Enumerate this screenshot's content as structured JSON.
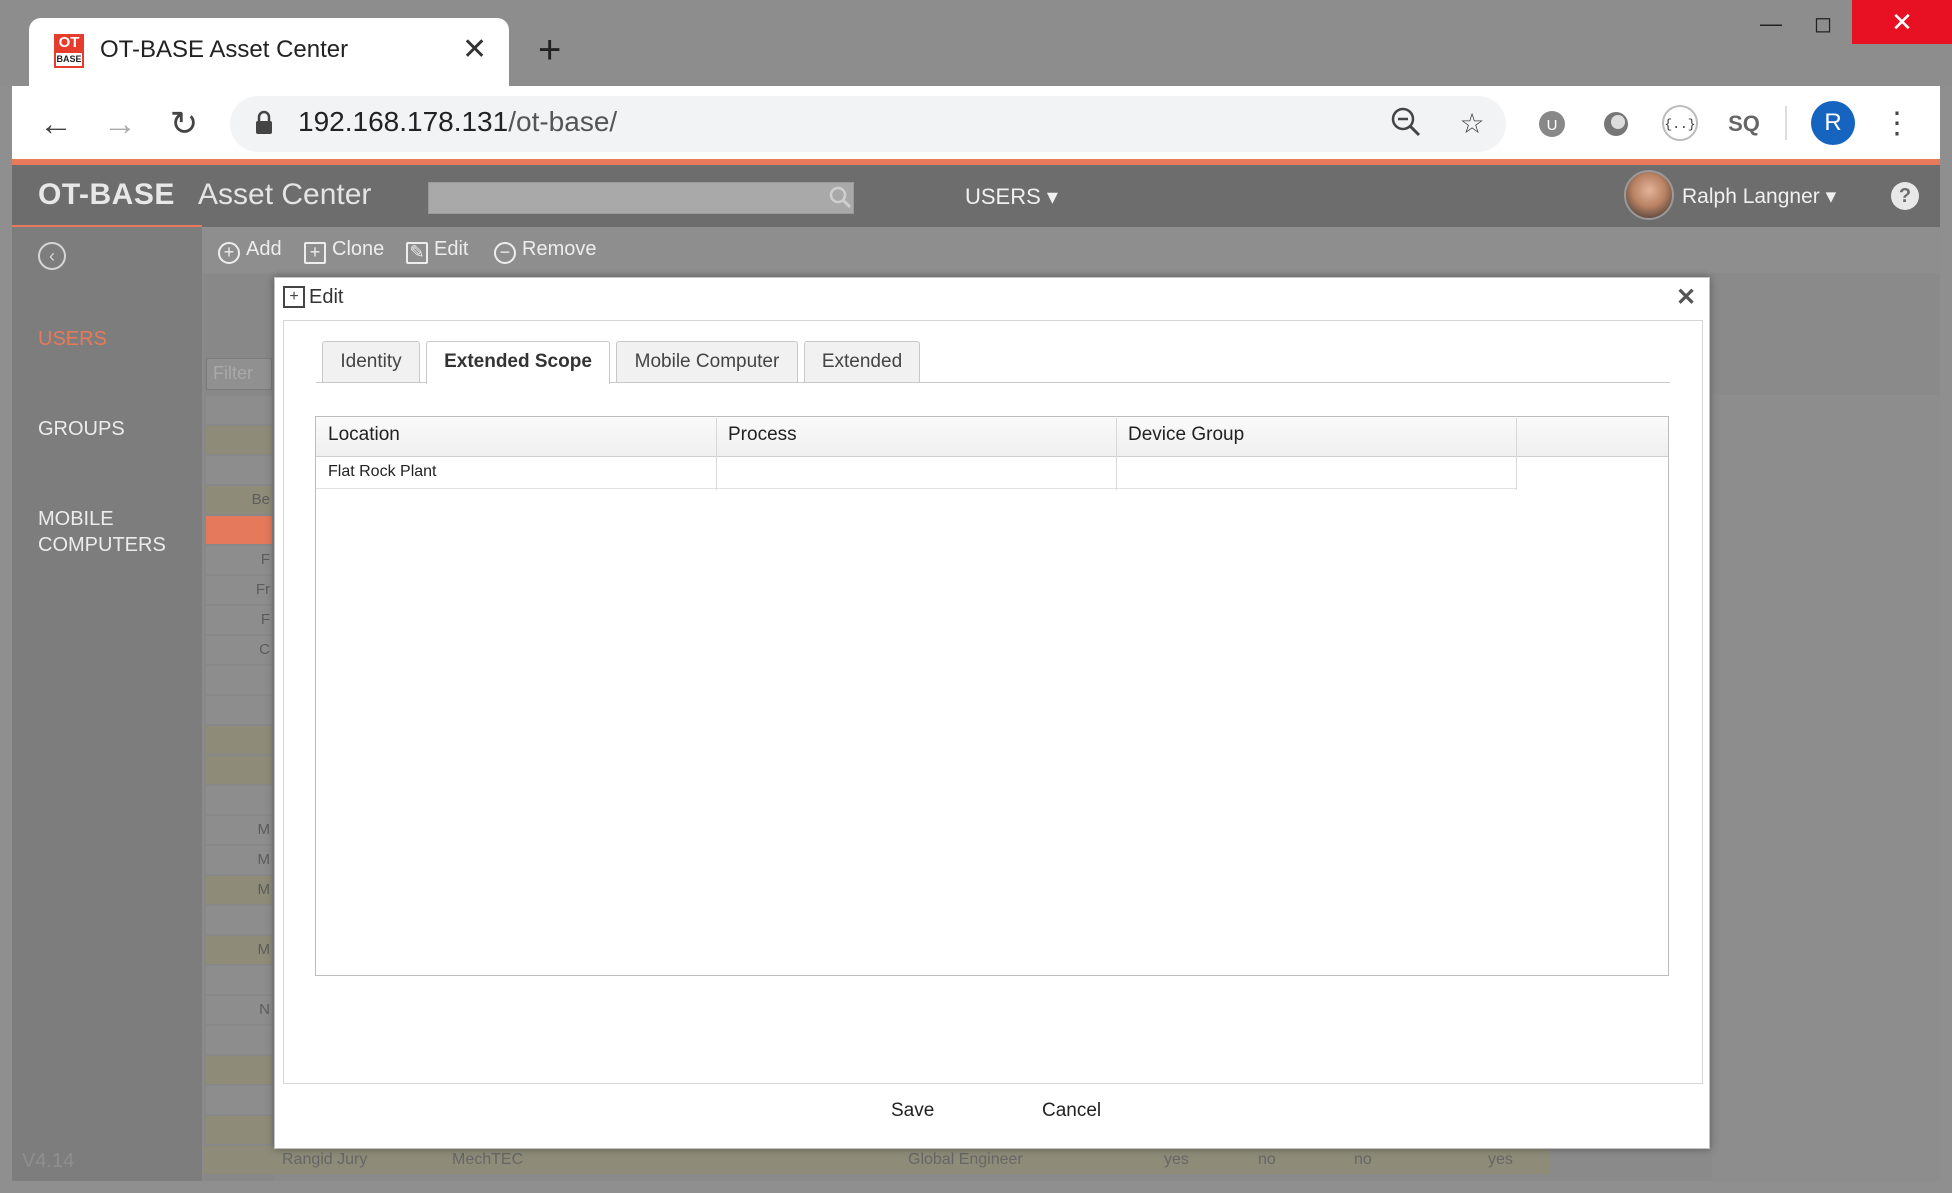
{
  "browser": {
    "tab_title": "OT-BASE Asset Center",
    "favicon_top": "OT",
    "favicon_bottom": "BASE",
    "url_host": "192.168.178.131",
    "url_path": "/ot-base/",
    "profile_initial": "R"
  },
  "app": {
    "brand": "OT-BASE",
    "subtitle": "Asset Center",
    "menu": "USERS ▾",
    "user_name": "Ralph Langner ▾",
    "help": "?",
    "version": "V4.14"
  },
  "sidebar": {
    "items": [
      {
        "label": "USERS",
        "active": true
      },
      {
        "label": "GROUPS"
      },
      {
        "label": "MOBILE COMPUTERS"
      }
    ]
  },
  "toolbar": {
    "add": "Add",
    "clone": "Clone",
    "edit": "Edit",
    "remove": "Remove"
  },
  "list": {
    "filter_placeholder": "Filter",
    "row_fragments": [
      "Be",
      "F",
      "Fr",
      "F",
      "C",
      "M",
      "M",
      "M",
      "M",
      "N"
    ],
    "bottom_row": [
      "Rangid Jury",
      "MechTEC",
      "Global Engineer",
      "yes",
      "no",
      "no",
      "yes"
    ]
  },
  "modal": {
    "title": "Edit",
    "tabs": [
      "Identity",
      "Extended Scope",
      "Mobile Computer",
      "Extended"
    ],
    "active_tab": "Extended Scope",
    "columns": [
      "Location",
      "Process",
      "Device Group"
    ],
    "rows": [
      {
        "location": "Flat Rock Plant",
        "process": "",
        "device_group": ""
      }
    ],
    "save": "Save",
    "cancel": "Cancel"
  },
  "colors": {
    "accent": "#e8795a",
    "header": "#6d6d6d",
    "sidebar": "#7d7d7d",
    "close_button": "#e81123",
    "profile": "#1565c0"
  }
}
